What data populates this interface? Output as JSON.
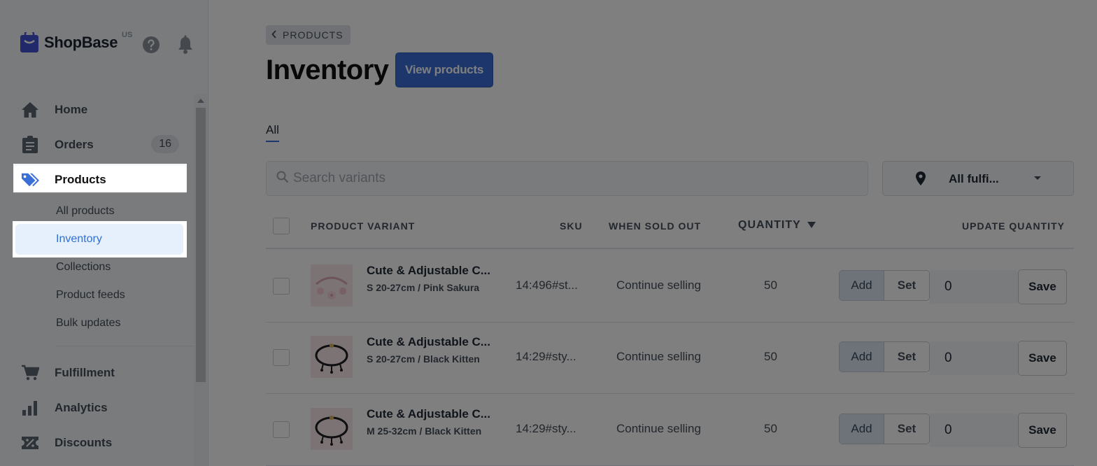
{
  "brand": {
    "name": "ShopBase",
    "region": "US"
  },
  "sidebar": {
    "items": [
      {
        "label": "Home",
        "icon": "home-icon"
      },
      {
        "label": "Orders",
        "icon": "clipboard-icon",
        "badge": "16"
      },
      {
        "label": "Products",
        "icon": "tag-icon"
      },
      {
        "label": "Fulfillment",
        "icon": "cart-icon"
      },
      {
        "label": "Analytics",
        "icon": "bar-chart-icon"
      },
      {
        "label": "Discounts",
        "icon": "discount-icon"
      }
    ],
    "sub_items": [
      {
        "label": "All products"
      },
      {
        "label": "Inventory"
      },
      {
        "label": "Collections"
      },
      {
        "label": "Product feeds"
      },
      {
        "label": "Bulk updates"
      }
    ]
  },
  "breadcrumb": {
    "label": "PRODUCTS"
  },
  "page": {
    "title": "Inventory",
    "view_button": "View products"
  },
  "tabs": [
    {
      "label": "All"
    }
  ],
  "search": {
    "placeholder": "Search variants"
  },
  "fulfillment_filter": {
    "value": "All fulfi..."
  },
  "table": {
    "headers": {
      "product_variant": "PRODUCT VARIANT",
      "sku": "SKU",
      "when_sold_out": "WHEN SOLD OUT",
      "quantity": "QUANTITY",
      "update_quantity": "UPDATE QUANTITY"
    },
    "rows": [
      {
        "name": "Cute & Adjustable C...",
        "variant": "S 20-27cm / Pink Sakura",
        "sku": "14:496#st...",
        "when_sold_out": "Continue selling",
        "quantity": "50",
        "add_label": "Add",
        "set_label": "Set",
        "update_value": "0",
        "save_label": "Save"
      },
      {
        "name": "Cute & Adjustable C...",
        "variant": "S 20-27cm / Black Kitten",
        "sku": "14:29#sty...",
        "when_sold_out": "Continue selling",
        "quantity": "50",
        "add_label": "Add",
        "set_label": "Set",
        "update_value": "0",
        "save_label": "Save"
      },
      {
        "name": "Cute & Adjustable C...",
        "variant": "M 25-32cm / Black Kitten",
        "sku": "14:29#sty...",
        "when_sold_out": "Continue selling",
        "quantity": "50",
        "add_label": "Add",
        "set_label": "Set",
        "update_value": "0",
        "save_label": "Save"
      }
    ]
  },
  "colors": {
    "accent": "#3b6fd8",
    "active_sub_bg": "#e6f0fd",
    "active_sub_text": "#2f6fd6",
    "overlay": "rgba(0,0,0,0.5)"
  }
}
